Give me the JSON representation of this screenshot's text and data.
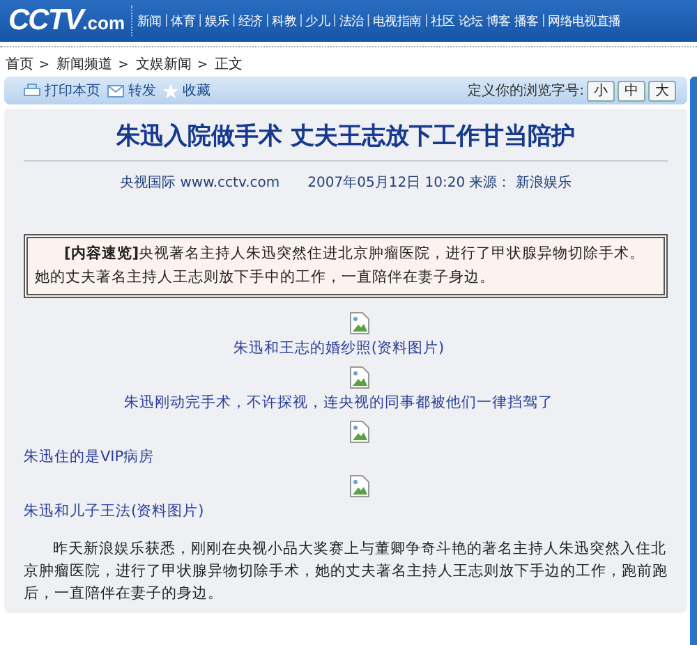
{
  "header": {
    "logo": {
      "main": "CCTV",
      "suffix": ".com"
    },
    "nav": [
      "新闻",
      "体育",
      "娱乐",
      "经济",
      "科教",
      "少儿",
      "法治",
      "电视指南",
      "社区 论坛 博客 播客",
      "网络电视直播"
    ],
    "nav_separator": "|"
  },
  "breadcrumb": {
    "items": [
      "首页",
      "新闻频道",
      "文娱新闻",
      "正文"
    ],
    "separator": ">"
  },
  "toolbar": {
    "actions": [
      {
        "label": "打印本页",
        "kind": "print"
      },
      {
        "label": "转发",
        "kind": "mail"
      },
      {
        "label": "收藏",
        "kind": "star"
      }
    ],
    "font_size_label": "定义你的浏览字号:",
    "font_sizes": [
      "小",
      "中",
      "大"
    ]
  },
  "article": {
    "title": "朱迅入院做手术 丈夫王志放下工作甘当陪护",
    "source": "央视国际 www.cctv.com",
    "date": "2007年05月12日 10:20 来源： 新浪娱乐",
    "summary": {
      "label": "[内容速览]",
      "text": "央视著名主持人朱迅突然住进北京肿瘤医院，进行了甲状腺异物切除手术。她的丈夫著名主持人王志则放下手中的工作，一直陪伴在妻子身边。"
    },
    "figures": [
      {
        "caption": "朱迅和王志的婚纱照(资料图片)",
        "kind": "centered"
      },
      {
        "caption": "朱迅刚动完手术，不许探视，连央视的同事都被他们一律挡驾了",
        "kind": "centered"
      },
      {
        "caption": "朱迅住的是VIP病房",
        "kind": "flush"
      },
      {
        "caption": "朱迅和儿子王法(资料图片)",
        "kind": "flush"
      }
    ],
    "body": "昨天新浪娱乐获悉，刚刚在央视小品大奖赛上与董卿争奇斗艳的著名主持人朱迅突然入住北京肿瘤医院，进行了甲状腺异物切除手术，她的丈夫著名主持人王志则放下手边的工作，跑前跑后，一直陪伴在妻子的身边。"
  }
}
